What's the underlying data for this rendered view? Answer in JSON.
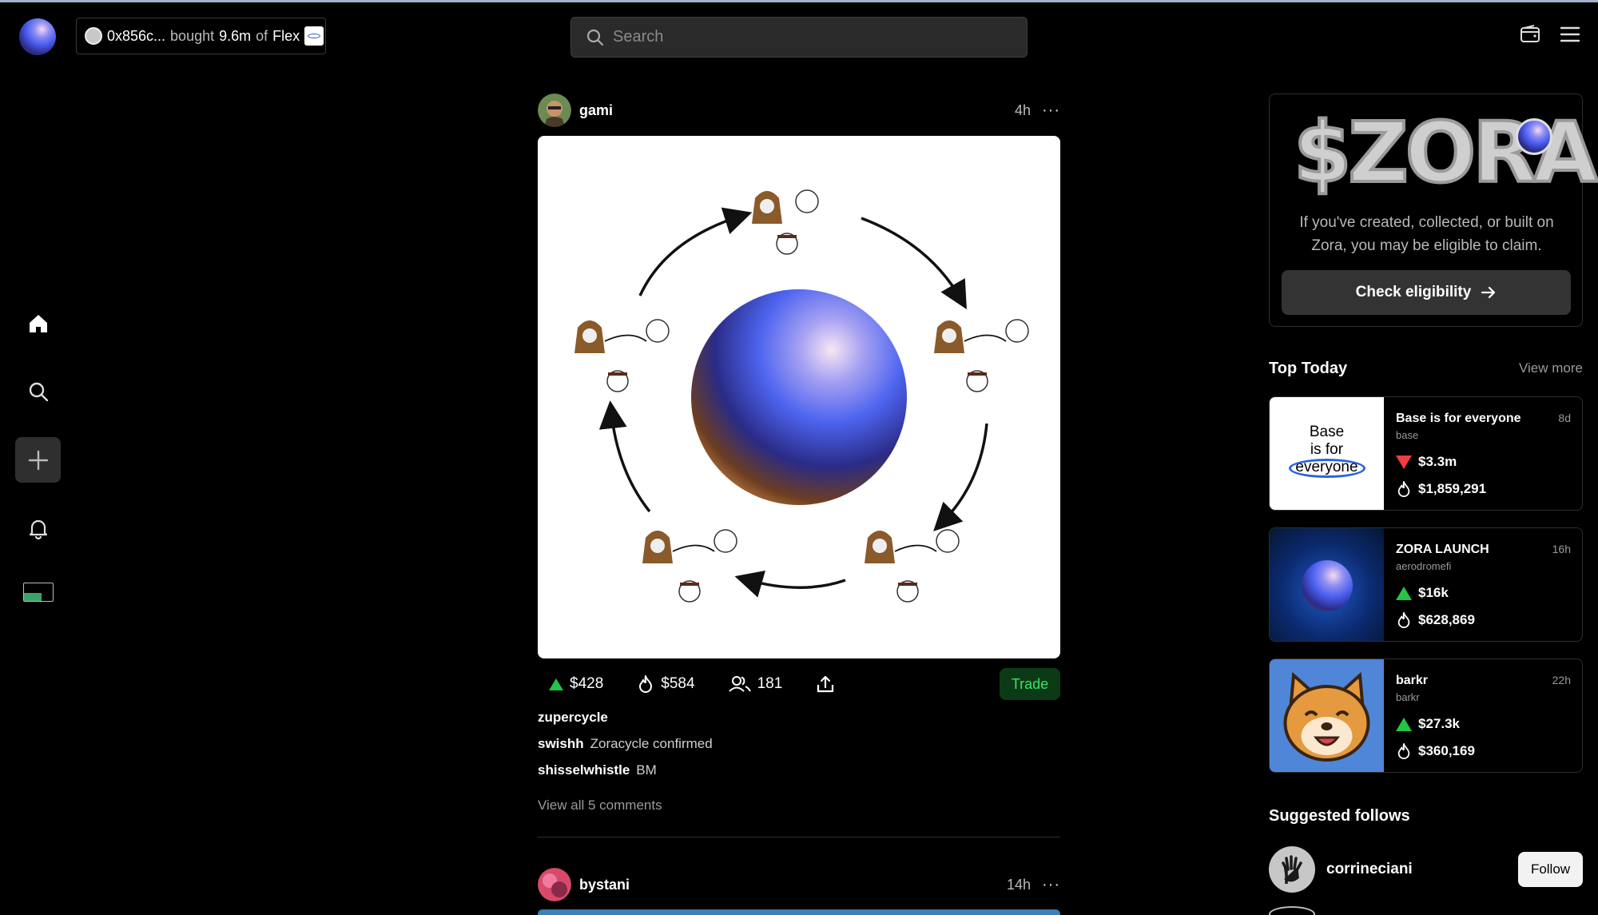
{
  "colors": {
    "accent_green": "#23c544",
    "accent_red": "#f03d3d",
    "trade_bg": "#0d3a16"
  },
  "activity": {
    "address": "0x856c...",
    "verb": "bought",
    "amount": "9.6m",
    "of": "of",
    "coin": "Flex"
  },
  "search": {
    "placeholder": "Search"
  },
  "nav": {
    "items": [
      "home-icon",
      "search-icon",
      "plus-icon",
      "bell-icon",
      "profile-avatar"
    ]
  },
  "posts": [
    {
      "author": "gami",
      "time": "4h",
      "more": "···",
      "market_cap": "$428",
      "volume": "$584",
      "holders": "181",
      "trade_label": "Trade",
      "title": "zupercycle",
      "comments": [
        {
          "user": "swishh",
          "text": "Zoracycle confirmed"
        },
        {
          "user": "shisselwhistle",
          "text": "BM"
        }
      ],
      "view_all": "View all 5 comments"
    },
    {
      "author": "bystani",
      "time": "14h",
      "more": "···"
    }
  ],
  "promo": {
    "title": "$ZORA",
    "text": "If you've created, collected, or built on Zora, you may be eligible to claim.",
    "button": "Check eligibility"
  },
  "top_today": {
    "title": "Top Today",
    "view_more": "View more",
    "items": [
      {
        "name": "Base is for everyone",
        "creator": "base",
        "age": "8d",
        "market_cap": "$3.3m",
        "trend": "down",
        "volume": "$1,859,291",
        "thumb_text": [
          "Base",
          "is for",
          "everyone"
        ]
      },
      {
        "name": "ZORA LAUNCH",
        "creator": "aerodromefi",
        "age": "16h",
        "market_cap": "$16k",
        "trend": "up",
        "volume": "$628,869"
      },
      {
        "name": "barkr",
        "creator": "barkr",
        "age": "22h",
        "market_cap": "$27.3k",
        "trend": "up",
        "volume": "$360,169"
      }
    ]
  },
  "suggested": {
    "title": "Suggested follows",
    "items": [
      {
        "name": "corrineciani",
        "button": "Follow"
      }
    ]
  }
}
